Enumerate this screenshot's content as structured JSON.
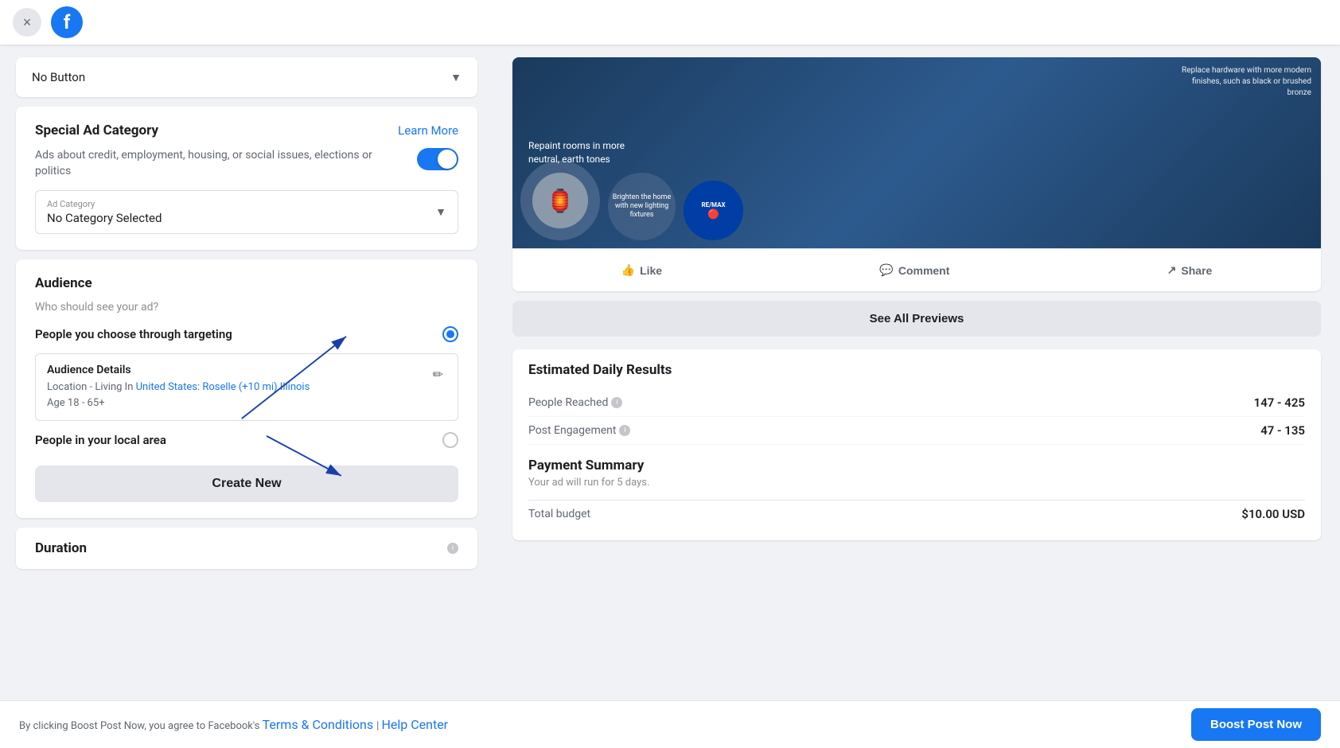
{
  "topbar": {
    "close_label": "×",
    "facebook_letter": "f"
  },
  "no_button_section": {
    "label": "No Button",
    "dropdown_arrow": "▼"
  },
  "special_ad_category": {
    "title": "Special Ad Category",
    "learn_more": "Learn More",
    "toggle_label": "Ads about credit, employment, housing, or social issues, elections or politics",
    "toggle_enabled": true,
    "dropdown": {
      "label": "Ad Category",
      "value": "No Category Selected",
      "arrow": "▼"
    }
  },
  "audience": {
    "title": "Audience",
    "subtitle": "Who should see your ad?",
    "option_targeting": {
      "label": "People you choose through targeting",
      "selected": true
    },
    "audience_details": {
      "title": "Audience Details",
      "location_prefix": "Location - Living In ",
      "location_link": "United States: Roselle (+10 mi) Illinois",
      "age": "Age 18 - 65+"
    },
    "option_local": {
      "label": "People in your local area",
      "selected": false
    },
    "create_new_btn": "Create New"
  },
  "duration": {
    "title": "Duration",
    "info_icon": "ℹ"
  },
  "preview": {
    "ad_image_overlay_text": "Replace hardware with more modern finishes, such as black or brushed bronze",
    "ad_texts": [
      "Repaint rooms in more neutral, earth tones",
      "Brighten the home with new lighting fixtures"
    ],
    "remax_text": "RE/MAX",
    "like_btn": "Like",
    "comment_btn": "Comment",
    "share_btn": "Share",
    "see_all_btn": "See All Previews"
  },
  "estimated_results": {
    "title": "Estimated Daily Results",
    "people_reached_label": "People Reached",
    "people_reached_value": "147 - 425",
    "post_engagement_label": "Post Engagement",
    "post_engagement_value": "47 - 135"
  },
  "payment": {
    "title": "Payment Summary",
    "subtitle": "Your ad will run for 5 days.",
    "total_budget_label": "Total budget",
    "total_budget_value": "$10.00 USD"
  },
  "bottom_bar": {
    "text": "By clicking Boost Post Now, you agree to Facebook's ",
    "terms_link": "Terms & Conditions",
    "separator": " | ",
    "help_link": "Help Center",
    "boost_btn": "Boost Post Now"
  }
}
